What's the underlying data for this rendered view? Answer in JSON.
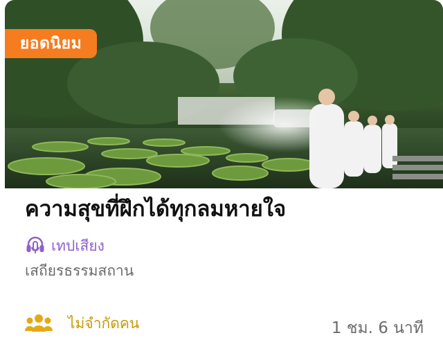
{
  "card": {
    "badge_label": "ยอดนิยม",
    "title": "ความสุขที่ฝึกได้ทุกลมหายใจ",
    "type_label": "เทปเสียง",
    "venue": "เสถียรธรรมสถาน",
    "capacity_label": "ไม่จำกัดคน",
    "duration": "1 ชม. 6 นาที"
  },
  "icons": {
    "type": "headphones-mic-icon",
    "capacity": "people-group-icon"
  },
  "colors": {
    "badge": "#f57c1f",
    "type_label": "#8f5fcc",
    "capacity_label": "#c79a0b",
    "title": "#111111",
    "secondary_text": "#6b6b6b"
  }
}
